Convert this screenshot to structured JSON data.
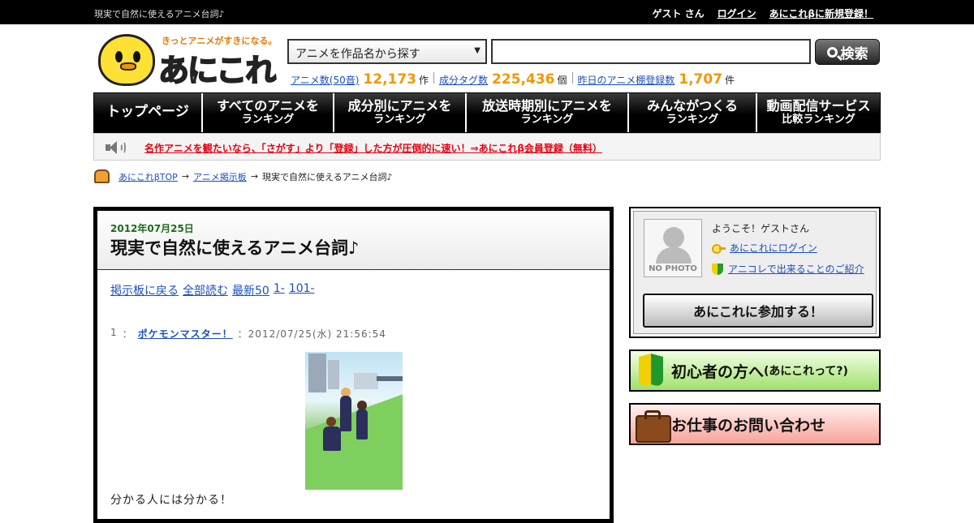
{
  "topbar": {
    "tagline": "現実で自然に使えるアニメ台詞♪",
    "guest": "ゲスト さん",
    "login": "ログイン",
    "register": "あにこれβに新規登録！"
  },
  "logo": {
    "catchphrase": "きっとアニメがすきになる。",
    "name": "あにこれ"
  },
  "search": {
    "select_value": "アニメを作品名から探す",
    "input_value": "",
    "button_label": "検索"
  },
  "stats": [
    {
      "label": "アニメ数(50音)",
      "value": "12,173",
      "unit": "作"
    },
    {
      "label": "成分タグ数",
      "value": "225,436",
      "unit": "個"
    },
    {
      "label": "昨日のアニメ棚登録数",
      "value": "1,707",
      "unit": "件"
    }
  ],
  "gnav": [
    {
      "l1": "トップページ",
      "l2": ""
    },
    {
      "l1": "すべてのアニメを",
      "l2": "ランキング"
    },
    {
      "l1": "成分別にアニメを",
      "l2": "ランキング"
    },
    {
      "l1": "放送時期別にアニメを",
      "l2": "ランキング"
    },
    {
      "l1": "みんながつくる",
      "l2": "ランキング"
    },
    {
      "l1": "動画配信サービス",
      "l2": "比較ランキング"
    }
  ],
  "notice": {
    "text": "名作アニメを観たいなら、「さがす」より「登録」した方が圧倒的に速い！⇒あにこれβ会員登録（無料）"
  },
  "breadcrumb": {
    "items": [
      "あにこれβTOP",
      "アニメ掲示板",
      "現実で自然に使えるアニメ台詞♪"
    ],
    "separator": "→"
  },
  "thread": {
    "date": "2012年07月25日",
    "title": "現実で自然に使えるアニメ台詞♪",
    "nav": [
      "掲示板に戻る",
      "全部読む",
      "最新50",
      "1-",
      "101-"
    ],
    "post": {
      "number": "1",
      "colon": "：",
      "author": "ポケモンマスター！",
      "timestamp": "：2012/07/25(水) 21:56:54",
      "body": "分かる人には分かる！"
    }
  },
  "sidebar": {
    "nophoto_label": "NO PHOTO",
    "welcome": "ようこそ！ゲストさん",
    "login_link": "あにこれにログイン",
    "intro_link": "アニコレで出来ることのご紹介",
    "join_button": "あにこれに参加する！",
    "beginner_banner": {
      "main": "初心者の方へ",
      "sub": "(あにこれって?)"
    },
    "work_banner": {
      "main": "お仕事のお問い合わせ"
    }
  },
  "colors": {
    "accent_orange": "#f39800",
    "notice_red": "#e60012",
    "link_blue": "#1a4fbf",
    "date_green": "#1e6b1e"
  }
}
